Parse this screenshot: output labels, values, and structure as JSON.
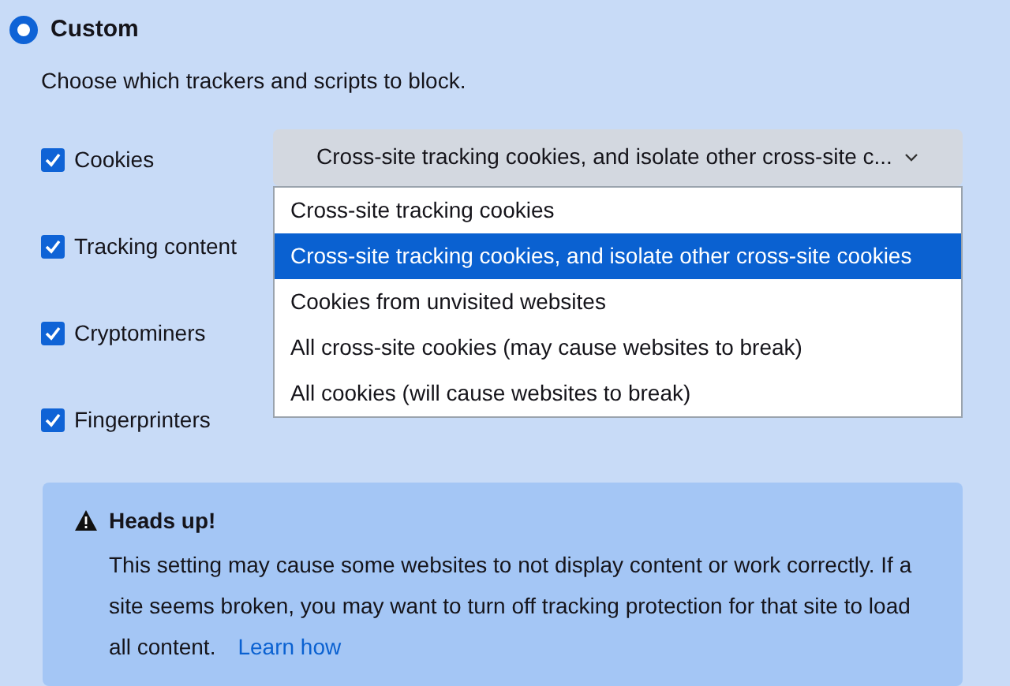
{
  "option": {
    "label": "Custom",
    "selected": true
  },
  "description": "Choose which trackers and scripts to block.",
  "trackers": [
    {
      "label": "Cookies",
      "checked": true
    },
    {
      "label": "Tracking content",
      "checked": true
    },
    {
      "label": "Cryptominers",
      "checked": true
    },
    {
      "label": "Fingerprinters",
      "checked": true
    }
  ],
  "cookie_select": {
    "value": "Cross-site tracking cookies, and isolate other cross-site c...",
    "expanded": true,
    "options": [
      {
        "label": "Cross-site tracking cookies",
        "selected": false
      },
      {
        "label": "Cross-site tracking cookies, and isolate other cross-site cookies",
        "selected": true
      },
      {
        "label": "Cookies from unvisited websites",
        "selected": false
      },
      {
        "label": "All cross-site cookies (may cause websites to break)",
        "selected": false
      },
      {
        "label": "All cookies (will cause websites to break)",
        "selected": false
      }
    ]
  },
  "alert": {
    "title": "Heads up!",
    "message": "This setting may cause some websites to not display content or work correctly. If a site seems broken, you may want to turn off tracking protection for that site to load all content.",
    "link": "Learn how"
  }
}
